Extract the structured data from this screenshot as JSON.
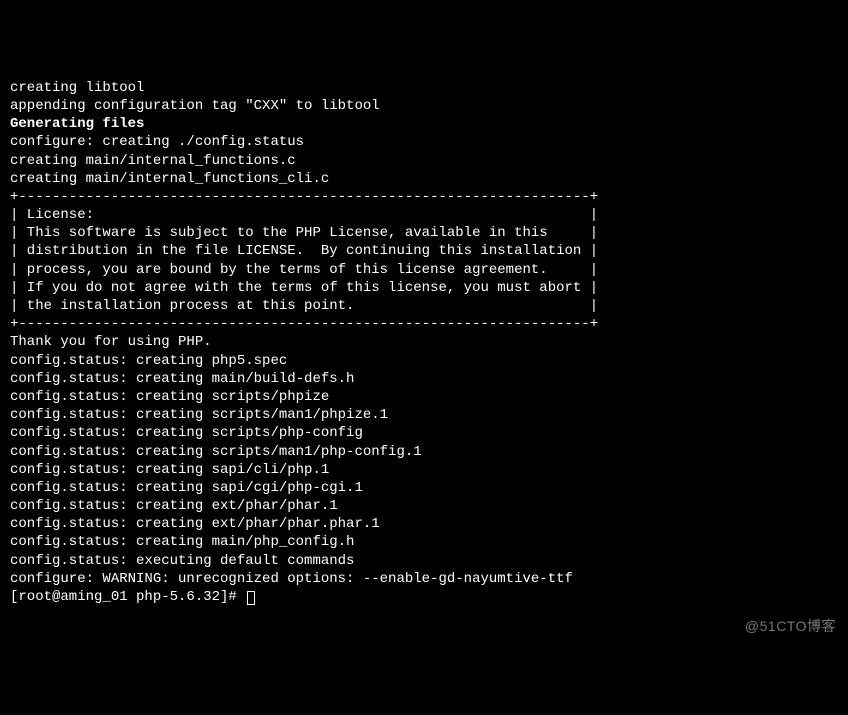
{
  "pre_lines": [
    "creating libtool",
    "appending configuration tag \"CXX\" to libtool",
    ""
  ],
  "heading": "Generating files",
  "gen_lines": [
    "configure: creating ./config.status",
    "creating main/internal_functions.c",
    "creating main/internal_functions_cli.c"
  ],
  "license_box": {
    "border": "+--------------------------------------------------------------------+",
    "lines": [
      "| License:                                                           |",
      "| This software is subject to the PHP License, available in this     |",
      "| distribution in the file LICENSE.  By continuing this installation |",
      "| process, you are bound by the terms of this license agreement.     |",
      "| If you do not agree with the terms of this license, you must abort |",
      "| the installation process at this point.                            |"
    ]
  },
  "thank_you": "Thank you for using PHP.",
  "status_lines": [
    "config.status: creating php5.spec",
    "config.status: creating main/build-defs.h",
    "config.status: creating scripts/phpize",
    "config.status: creating scripts/man1/phpize.1",
    "config.status: creating scripts/php-config",
    "config.status: creating scripts/man1/php-config.1",
    "config.status: creating sapi/cli/php.1",
    "config.status: creating sapi/cgi/php-cgi.1",
    "config.status: creating ext/phar/phar.1",
    "config.status: creating ext/phar/phar.phar.1",
    "config.status: creating main/php_config.h",
    "config.status: executing default commands",
    "configure: WARNING: unrecognized options: --enable-gd-nayumtive-ttf"
  ],
  "prompt": "[root@aming_01 php-5.6.32]# ",
  "watermark": "@51CTO博客"
}
